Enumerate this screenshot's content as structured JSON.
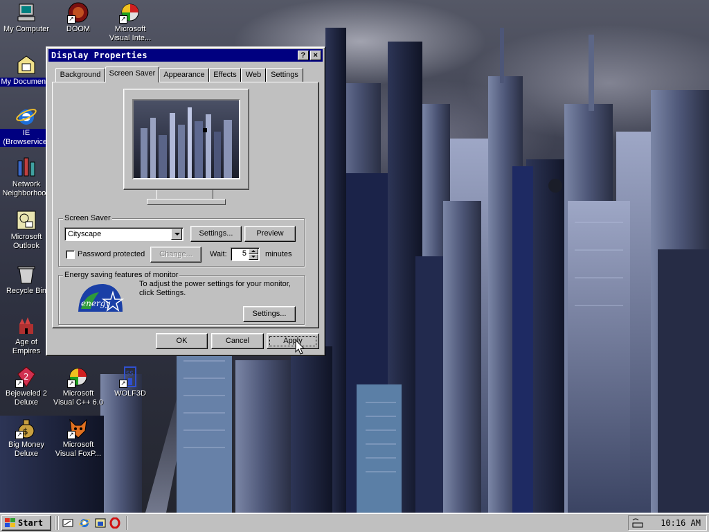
{
  "desktop": {
    "icons": [
      {
        "label": "My Computer"
      },
      {
        "label": "DOOM"
      },
      {
        "label": "Microsoft Visual Inte..."
      },
      {
        "label": "My Documents"
      },
      {
        "label": "IE (Browservice)"
      },
      {
        "label": "Network Neighborhood"
      },
      {
        "label": "Microsoft Outlook"
      },
      {
        "label": "Recycle Bin"
      },
      {
        "label": "Age of Empires"
      },
      {
        "label": "Bejeweled 2 Deluxe"
      },
      {
        "label": "Microsoft Visual C++ 6.0"
      },
      {
        "label": "WOLF3D"
      },
      {
        "label": "Big Money Deluxe"
      },
      {
        "label": "Microsoft Visual FoxP..."
      }
    ]
  },
  "dialog": {
    "title": "Display Properties",
    "help_glyph": "?",
    "close_glyph": "×",
    "tabs": [
      {
        "label": "Background"
      },
      {
        "label": "Screen Saver"
      },
      {
        "label": "Appearance"
      },
      {
        "label": "Effects"
      },
      {
        "label": "Web"
      },
      {
        "label": "Settings"
      }
    ],
    "active_tab": "Screen Saver",
    "screensaver": {
      "group_label": "Screen Saver",
      "selected": "Cityscape",
      "settings_label": "Settings...",
      "preview_label": "Preview",
      "password_label": "Password protected",
      "password_checked": false,
      "change_label": "Change...",
      "wait_label": "Wait:",
      "wait_value": "5",
      "minutes_label": "minutes"
    },
    "energy": {
      "group_label": "Energy saving features of monitor",
      "logo_text": "energy",
      "description": "To adjust the power settings for your monitor, click Settings.",
      "settings_label": "Settings..."
    },
    "buttons": {
      "ok": "OK",
      "cancel": "Cancel",
      "apply": "Apply"
    }
  },
  "taskbar": {
    "start_label": "Start",
    "clock": "10:16 AM",
    "quicklaunch": [
      "show-desktop-icon",
      "ie-icon",
      "outlook-icon",
      "opera-icon"
    ]
  },
  "colors": {
    "titlebar": "#000080",
    "face": "#c0c0c0",
    "selection": "#000080"
  }
}
